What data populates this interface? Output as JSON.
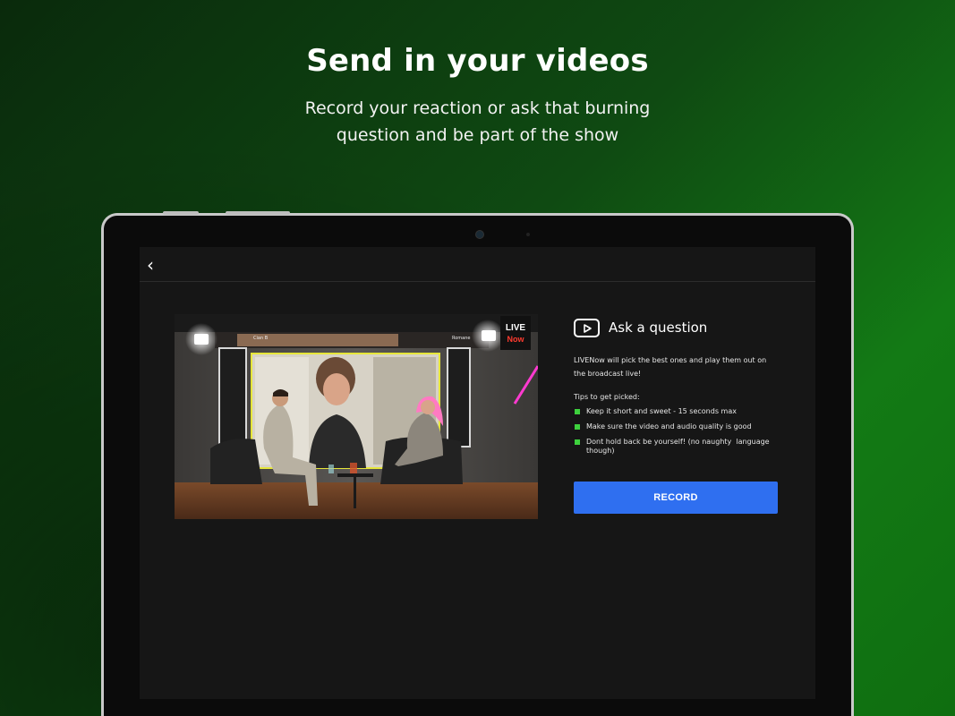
{
  "promo": {
    "title": "Send in your videos",
    "subtitle": "Record your reaction or ask that burning question and be part of the show"
  },
  "app": {
    "back_icon": "chevron-left-icon",
    "video": {
      "logo_line1": "LIVE",
      "logo_line2": "Now",
      "name_tag_left": "Cian B",
      "name_tag_right": "Romane"
    },
    "panel": {
      "icon": "play-video-icon",
      "title": "Ask a question",
      "intro": "LIVENow will pick the best ones and play them out on the broadcast live!",
      "tips_heading": "Tips to get picked:",
      "tips": [
        "Keep it short and sweet - 15 seconds max",
        "Make sure the video and audio quality is good",
        "Dont hold back be yourself! (no naughty  language though)"
      ]
    },
    "record_label": "RECORD"
  },
  "colors": {
    "accent_button": "#2f6ff0",
    "bullet": "#3dd13d",
    "background_green": "#137a15"
  }
}
